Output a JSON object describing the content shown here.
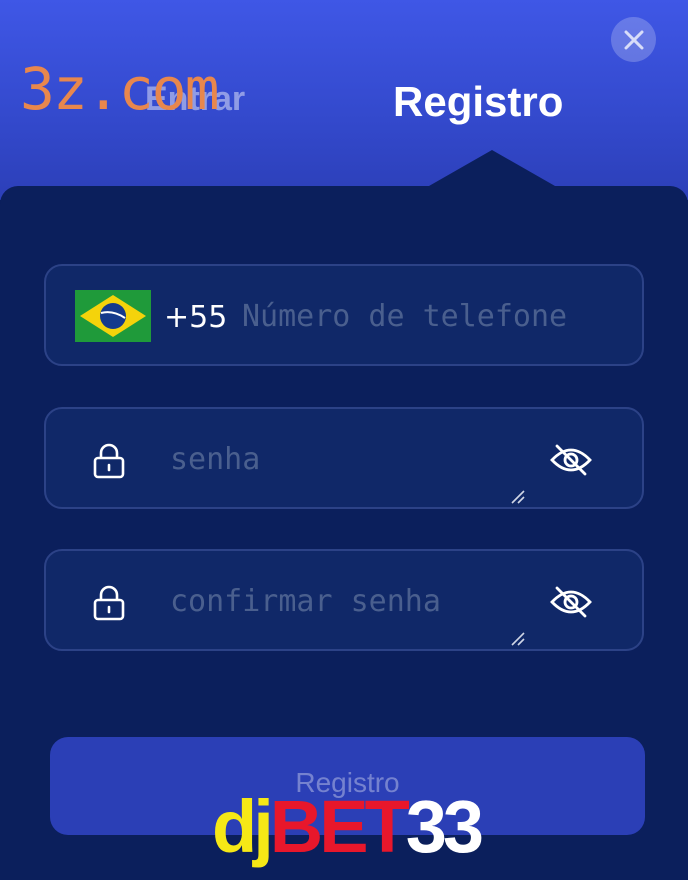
{
  "watermark": "3z.com",
  "tabs": {
    "login": "Entrar",
    "register": "Registro"
  },
  "form": {
    "phone": {
      "country_code": "+55",
      "placeholder": "Número de telefone",
      "flag_icon": "brazil-flag-icon"
    },
    "password": {
      "placeholder": "senha"
    },
    "confirm_password": {
      "placeholder": "confirmar senha"
    },
    "submit_label": "Registro"
  },
  "brand": {
    "part1": "dj",
    "part2": "BET",
    "part3": "33"
  },
  "colors": {
    "header_top": "#3f57e6",
    "panel": "#0b1f5c",
    "field_bg": "#102868",
    "field_border": "#2c4287",
    "button_bg": "#2b3fb6",
    "brand_yellow": "#f6e816",
    "brand_red": "#e8172b",
    "watermark": "#e8874d"
  },
  "icons": [
    "close-icon",
    "brazil-flag-icon",
    "lock-icon",
    "eye-off-icon",
    "resize-grip-icon"
  ]
}
